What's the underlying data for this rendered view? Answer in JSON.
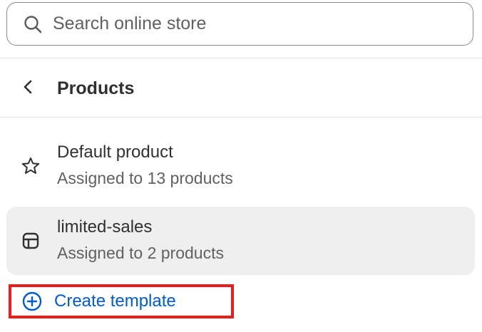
{
  "search": {
    "placeholder": "Search online store"
  },
  "header": {
    "back_icon": "chevron-left-icon",
    "title": "Products"
  },
  "templates": [
    {
      "icon": "star-icon",
      "name": "Default product",
      "assigned": "Assigned to 13 products",
      "selected": false
    },
    {
      "icon": "template-layout-icon",
      "name": "limited-sales",
      "assigned": "Assigned to 2 products",
      "selected": true
    }
  ],
  "create_template": {
    "icon": "plus-circle-icon",
    "label": "Create template",
    "highlight_color": "#ea1c1c"
  },
  "colors": {
    "link": "#005bd3",
    "selected_bg": "#efefef",
    "text": "#303030",
    "subtext": "#616161"
  }
}
